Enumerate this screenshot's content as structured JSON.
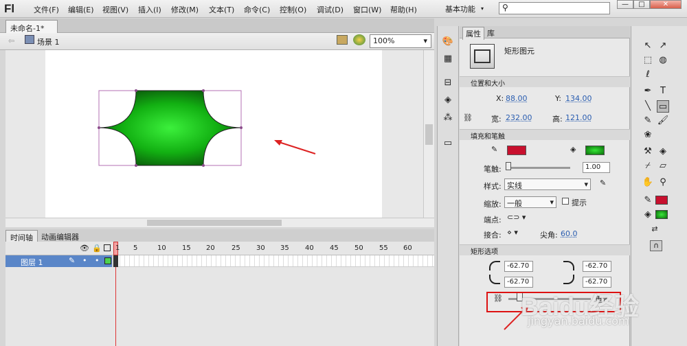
{
  "app": {
    "logo": "Fl",
    "menu": [
      "文件(F)",
      "编辑(E)",
      "视图(V)",
      "插入(I)",
      "修改(M)",
      "文本(T)",
      "命令(C)",
      "控制(O)",
      "调试(D)",
      "窗口(W)",
      "帮助(H)"
    ],
    "workspace": "基本功能",
    "window_buttons": [
      "—",
      "□",
      "✕"
    ]
  },
  "document": {
    "tab": "未命名-1*",
    "tab_close": "×",
    "scene": "场景 1",
    "zoom": "100%"
  },
  "timeline": {
    "tabs": [
      "时间轴",
      "动画编辑器"
    ],
    "frame_numbers": [
      "1",
      "5",
      "10",
      "15",
      "20",
      "25",
      "30",
      "35",
      "40",
      "45",
      "50",
      "55",
      "60"
    ],
    "layer_name": "图层 1"
  },
  "properties": {
    "tabs": [
      "属性",
      "库"
    ],
    "element_type": "矩形图元",
    "sections": {
      "position": "位置和大小",
      "fill": "填充和笔触",
      "rect": "矩形选项"
    },
    "x_label": "X:",
    "x": "88.00",
    "y_label": "Y:",
    "y": "134.00",
    "w_label": "宽:",
    "w": "232.00",
    "h_label": "高:",
    "h": "121.00",
    "stroke_label": "笔触:",
    "stroke_value": "1.00",
    "style_label": "样式:",
    "style_value": "实线",
    "scale_label": "缩放:",
    "scale_value": "一般",
    "hint_label": "提示",
    "cap_label": "端点:",
    "join_label": "接合:",
    "miter_label": "尖角:",
    "miter_value": "60.0",
    "corners": [
      "-62.70",
      "-62.70",
      "-62.70",
      "-62.70"
    ],
    "reset_label": "重置",
    "stroke_color": "#c8102e",
    "fill_color": "#1fae1f"
  },
  "watermark": {
    "main": "Baidu经验",
    "sub": "jingyan.baidu.com"
  }
}
